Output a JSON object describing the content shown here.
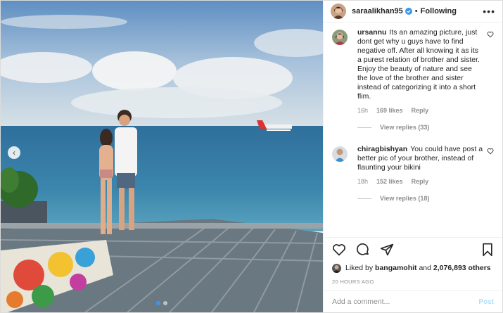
{
  "post": {
    "username": "saraalikhan95",
    "separator": "•",
    "follow_status": "Following",
    "more_label": "•••"
  },
  "comments": [
    {
      "username": "ursannu",
      "text": "Its an amazing picture, just dont get why u guys have to find negative off. After all knowing it as its a purest relation of brother and sister. Enjoy the beauty of nature and see the love of the brother and sister instead of categorizing it into a short flim.",
      "time": "16h",
      "likes": "169 likes",
      "reply_label": "Reply",
      "view_replies": "View replies (33)"
    },
    {
      "username": "chiragbishyan",
      "text": "You could have post a better pic of your brother, instead of flaunting your bikini",
      "time": "18h",
      "likes": "152 likes",
      "reply_label": "Reply",
      "view_replies": "View replies (18)"
    }
  ],
  "likes_line": {
    "prefix": "Liked by",
    "user": "bangamohit",
    "middle": "and",
    "count": "2,076,893 others"
  },
  "time_ago": "20 HOURS AGO",
  "comment_input": {
    "placeholder": "Add a comment..."
  },
  "post_button": "Post",
  "carousel": {
    "current": 1,
    "total": 2
  },
  "colors": {
    "accent": "#3897f0",
    "post_disabled": "#b2dffc",
    "muted": "#8e8e8e"
  }
}
